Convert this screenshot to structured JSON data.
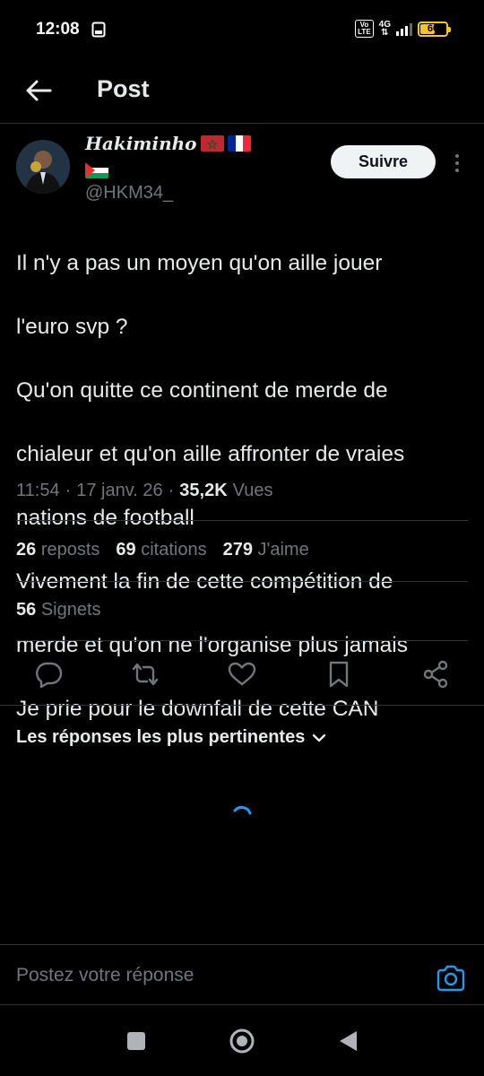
{
  "status_bar": {
    "time": "12:08",
    "volte": "Vo LTE",
    "network": "4G",
    "battery_percent": 60,
    "battery_label": "60",
    "battery_color": "#f3c623"
  },
  "header": {
    "title": "Post",
    "back_icon": "arrow-left-icon"
  },
  "author": {
    "display_name": "Hakiminho",
    "flags": [
      "morocco-flag",
      "france-flag",
      "palestine-flag"
    ],
    "handle": "@HKM34_",
    "follow_label": "Suivre"
  },
  "tweet": {
    "lines": [
      "Il n'y a pas un moyen qu'on aille jouer",
      "l'euro svp ?",
      "Qu'on quitte ce continent de merde de",
      "chialeur et qu'on aille affronter de vraies",
      "nations de football",
      "Vivement la fin de cette compétition de",
      "merde et qu'on ne l'organise plus jamais",
      "Je prie pour le downfall de cette CAN"
    ],
    "time": "11:54",
    "date": "17 janv. 26",
    "views": "35,2K",
    "views_label": "Vues"
  },
  "stats": {
    "reposts_count": "26",
    "reposts_label": "reposts",
    "quotes_count": "69",
    "quotes_label": "citations",
    "likes_count": "279",
    "likes_label": "J'aime",
    "bookmarks_count": "56",
    "bookmarks_label": "Signets"
  },
  "actions": [
    "reply-icon",
    "repost-icon",
    "like-icon",
    "bookmark-icon",
    "share-icon"
  ],
  "replies": {
    "sort_label": "Les réponses les plus pertinentes"
  },
  "reply_bar": {
    "placeholder": "Postez votre réponse"
  },
  "colors": {
    "background": "#000000",
    "text": "#e7e9ea",
    "secondary": "#71767b",
    "accent": "#1d9bf0",
    "divider": "#2f3336"
  }
}
